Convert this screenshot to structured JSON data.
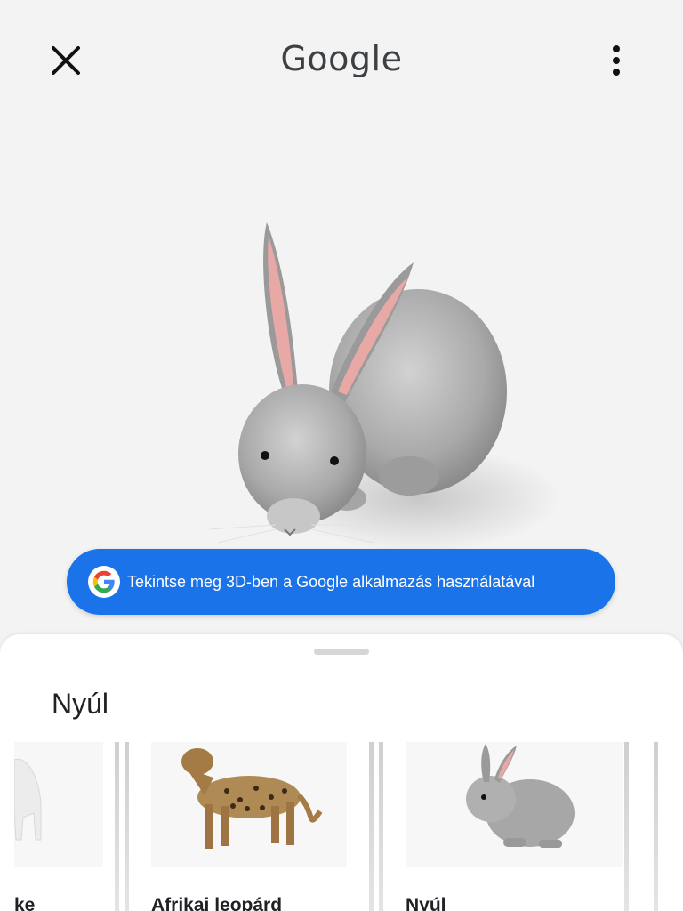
{
  "header": {
    "brand": "Google",
    "close_icon": "close-icon",
    "menu_icon": "more-vert-icon"
  },
  "viewer": {
    "model": "rabbit-3d-model",
    "cta_label": "Tekintse meg 3D-ben a Google alkalmazás használatával",
    "cta_icon": "google-g-icon",
    "cta_color": "#1a73e8"
  },
  "sheet": {
    "title": "Nyúl",
    "cards": [
      {
        "label": "ke",
        "image": "goat-image"
      },
      {
        "label": "Afrikai leopárd",
        "image": "leopard-image"
      },
      {
        "label": "Nyúl",
        "image": "rabbit-image"
      }
    ]
  }
}
